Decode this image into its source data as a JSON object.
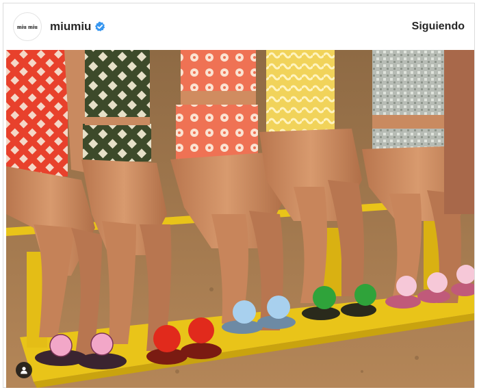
{
  "post": {
    "account_logo_text": "miu miu",
    "username": "miumiu",
    "verified": true,
    "follow_status": "Siguiendo"
  },
  "icons": {
    "verified_badge": "verified-check-icon",
    "user_tag": "user-tag-icon"
  },
  "colors": {
    "verified_blue": "#3897f0",
    "text_primary": "#262626",
    "border": "#dbdbdb"
  }
}
